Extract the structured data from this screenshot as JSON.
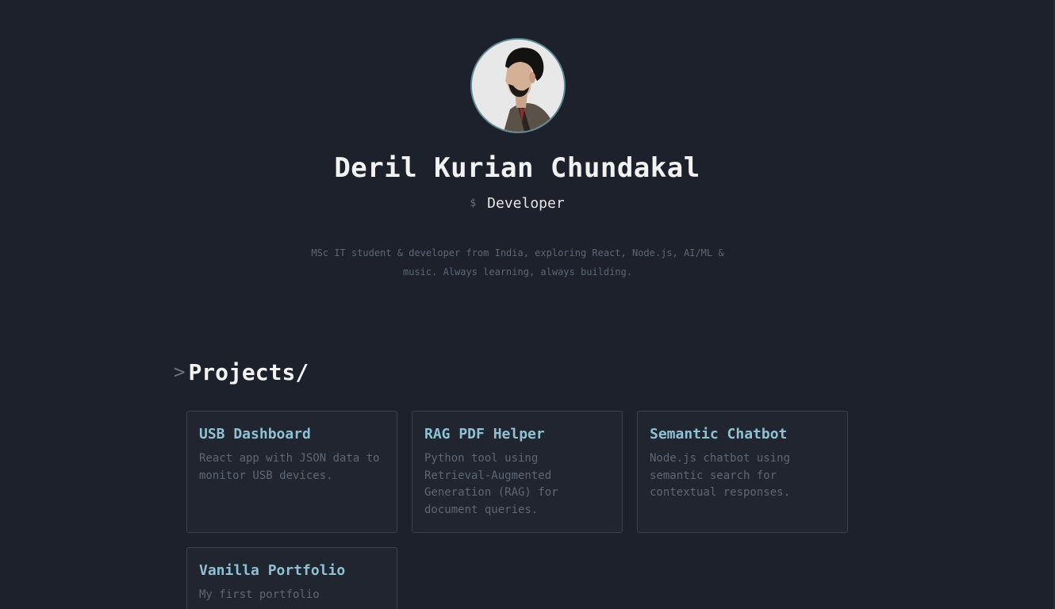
{
  "profile": {
    "name": "Deril Kurian Chundakal",
    "prompt_symbol": "$",
    "role": "Developer",
    "bio": "MSc IT student & developer from India, exploring React, Node.js, AI/ML & music. Always learning, always building.",
    "avatar_icon": "profile-photo"
  },
  "projects": {
    "prompt_symbol": ">",
    "title": "Projects/",
    "items": [
      {
        "title": "USB Dashboard",
        "description": "React app with JSON data to monitor USB devices."
      },
      {
        "title": "RAG PDF Helper",
        "description": "Python tool using Retrieval-Augmented Generation (RAG) for document queries."
      },
      {
        "title": "Semantic Chatbot",
        "description": "Node.js chatbot using semantic search for contextual responses."
      },
      {
        "title": "Vanilla Portfolio",
        "description": "My first portfolio"
      }
    ]
  },
  "colors": {
    "background": "#1c212b",
    "card_background": "#20252f",
    "accent": "#8fc1d4",
    "muted_text": "#5e6775",
    "heading_text": "#f2f2f2"
  }
}
